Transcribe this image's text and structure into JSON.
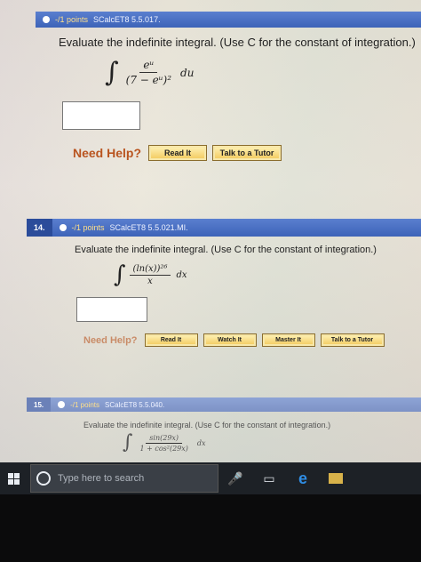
{
  "q13": {
    "header_points": "-/1 points",
    "header_source": "SCalcET8 5.5.017.",
    "prompt": "Evaluate the indefinite integral. (Use C for the constant of integration.)",
    "integral_symbol": "∫",
    "numerator": "eᵘ",
    "denominator": "(7 − eᵘ)²",
    "differential": "du",
    "help_label": "Need Help?",
    "buttons": [
      "Read It",
      "Talk to a Tutor"
    ]
  },
  "q14": {
    "number": "14.",
    "points": "-/1 points",
    "source": "SCalcET8 5.5.021.MI.",
    "prompt": "Evaluate the indefinite integral. (Use C for the constant of integration.)",
    "integral_symbol": "∫",
    "numerator": "(ln(x))²⁶",
    "denominator": "x",
    "differential": "dx",
    "help_label": "Need Help?",
    "buttons": [
      "Read It",
      "Watch It",
      "Master It",
      "Talk to a Tutor"
    ]
  },
  "q15": {
    "number": "15.",
    "points": "-/1 points",
    "source": "SCalcET8 5.5.040.",
    "prompt": "Evaluate the indefinite integral. (Use C for the constant of integration.)",
    "integral_symbol": "∫",
    "numerator": "sin(29x)",
    "denominator": "1 + cos²(29x)",
    "differential": "dx"
  },
  "taskbar": {
    "search_placeholder": "Type here to search",
    "icons": [
      "windows-icon",
      "search-ring-icon",
      "microphone-icon",
      "task-view-icon",
      "edge-icon",
      "folder-icon"
    ]
  }
}
